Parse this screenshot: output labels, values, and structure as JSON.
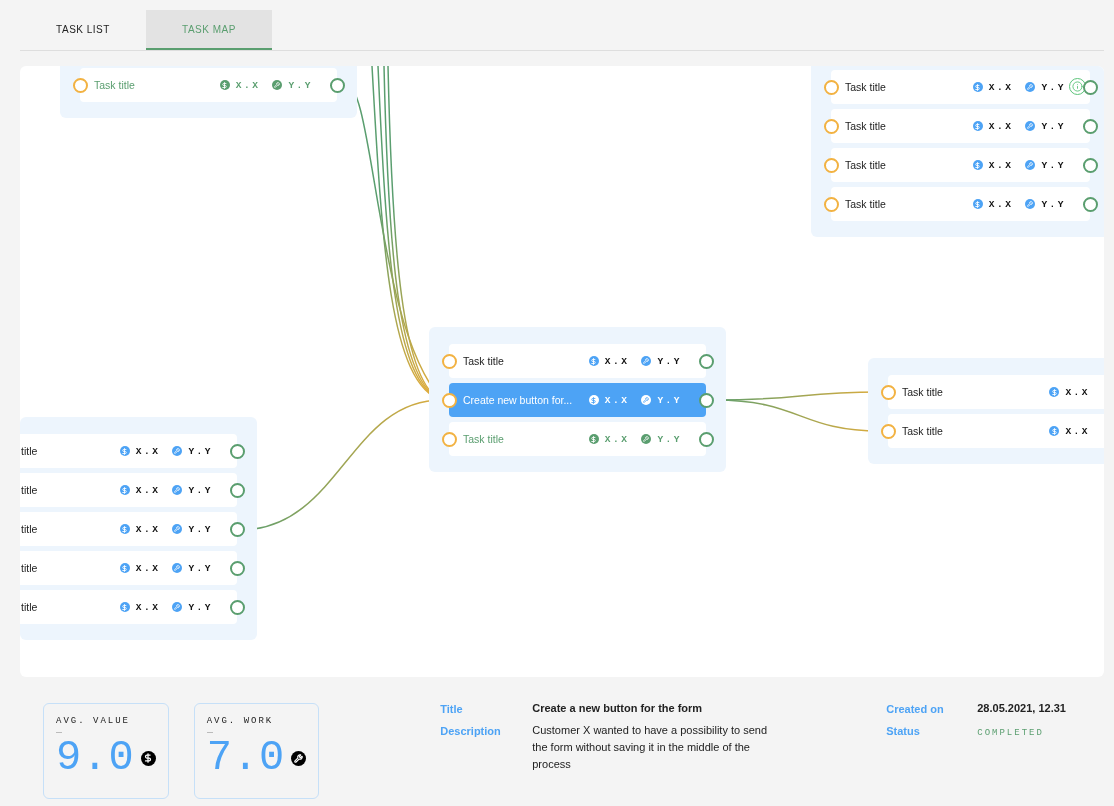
{
  "tabs": [
    {
      "label": "TASK LIST",
      "selected": false
    },
    {
      "label": "TASK MAP",
      "selected": true
    }
  ],
  "groups": [
    {
      "rows": [
        {
          "title": "Task title",
          "value": "X.X",
          "work": "Y.Y",
          "selected": false,
          "completed": true,
          "info_badge": false
        }
      ]
    },
    {
      "rows": [
        {
          "title": "Task title",
          "value": "X.X",
          "work": "Y.Y",
          "selected": false,
          "completed": false,
          "info_badge": true
        },
        {
          "title": "Task title",
          "value": "X.X",
          "work": "Y.Y",
          "selected": false,
          "completed": false,
          "info_badge": false
        },
        {
          "title": "Task title",
          "value": "X.X",
          "work": "Y.Y",
          "selected": false,
          "completed": false,
          "info_badge": false
        },
        {
          "title": "Task title",
          "value": "X.X",
          "work": "Y.Y",
          "selected": false,
          "completed": false,
          "info_badge": false
        }
      ]
    },
    {
      "rows": [
        {
          "title": "Task title",
          "value": "X.X",
          "work": "Y.Y",
          "selected": false,
          "completed": false,
          "info_badge": false
        },
        {
          "title": "Create new button for...",
          "value": "X.X",
          "work": "Y.Y",
          "selected": true,
          "completed": false,
          "info_badge": false
        },
        {
          "title": "Task title",
          "value": "X.X",
          "work": "Y.Y",
          "selected": false,
          "completed": true,
          "info_badge": false
        }
      ]
    },
    {
      "rows": [
        {
          "title": "Task title",
          "value": "X.X",
          "selected": false,
          "completed": false,
          "info_badge": false
        },
        {
          "title": "Task title",
          "value": "X.X",
          "selected": false,
          "completed": false,
          "info_badge": false
        }
      ]
    },
    {
      "rows": [
        {
          "title": "title",
          "value": "X.X",
          "work": "Y.Y",
          "selected": false,
          "completed": false,
          "info_badge": false
        },
        {
          "title": "title",
          "value": "X.X",
          "work": "Y.Y",
          "selected": false,
          "completed": false,
          "info_badge": false
        },
        {
          "title": "title",
          "value": "X.X",
          "work": "Y.Y",
          "selected": false,
          "completed": false,
          "info_badge": false
        },
        {
          "title": "title",
          "value": "X.X",
          "work": "Y.Y",
          "selected": false,
          "completed": false,
          "info_badge": false
        },
        {
          "title": "title",
          "value": "X.X",
          "work": "Y.Y",
          "selected": false,
          "completed": false,
          "info_badge": false
        }
      ]
    }
  ],
  "stats": [
    {
      "kind": "value",
      "label": "AVG. VALUE",
      "number": "9.0"
    },
    {
      "kind": "work",
      "label": "AVG. WORK",
      "number": "7.0"
    }
  ],
  "details": {
    "left": [
      {
        "label": "Title",
        "value": "Create a new button for the form",
        "kind": "bold"
      },
      {
        "label": "Description",
        "value": "Customer X wanted to have a possibility to send the form without saving it in the middle of the process",
        "kind": "text"
      }
    ],
    "right": [
      {
        "label": "Created on",
        "value": "28.05.2021, 12.31",
        "kind": "bold"
      },
      {
        "label": "Status",
        "value": "COMPLETED",
        "kind": "status"
      }
    ]
  }
}
